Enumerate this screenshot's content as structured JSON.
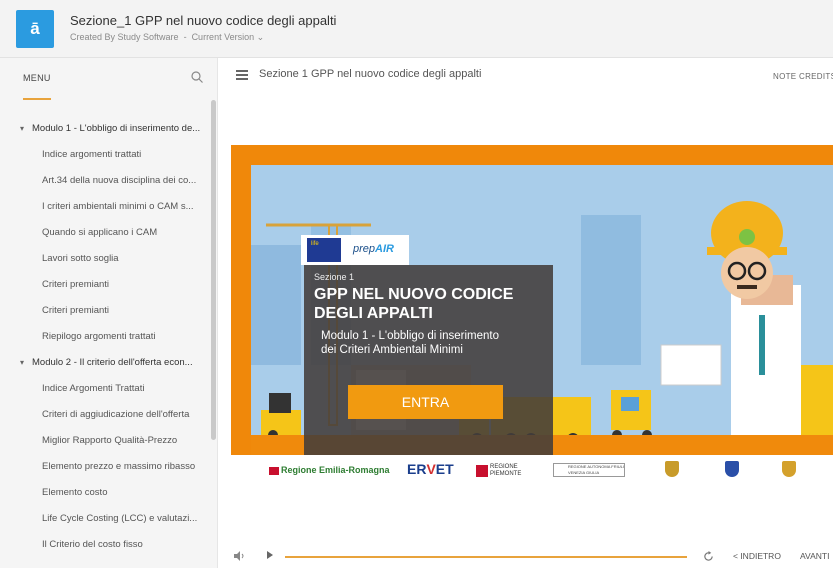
{
  "app": {
    "logo_glyph": "ā",
    "course_title": "Sezione_1 GPP nel nuovo codice degli appalti",
    "created_by": "Created By Study Software",
    "version": "Current Version ⌄"
  },
  "sidebar": {
    "menu_label": "MENU",
    "items": [
      {
        "type": "module",
        "label": "Modulo 1 - L'obbligo di inserimento de..."
      },
      {
        "type": "item",
        "label": "Indice argomenti trattati"
      },
      {
        "type": "item",
        "label": "Art.34 della nuova disciplina dei co..."
      },
      {
        "type": "item",
        "label": "I criteri ambientali minimi o CAM s..."
      },
      {
        "type": "item",
        "label": "Quando si applicano i CAM"
      },
      {
        "type": "item",
        "label": "Lavori sotto soglia"
      },
      {
        "type": "item",
        "label": "Criteri premianti"
      },
      {
        "type": "item",
        "label": "Criteri premianti"
      },
      {
        "type": "item",
        "label": "Riepilogo argomenti trattati"
      },
      {
        "type": "module",
        "label": "Modulo 2 - Il criterio dell'offerta econ..."
      },
      {
        "type": "item",
        "label": "Indice Argomenti Trattati"
      },
      {
        "type": "item",
        "label": "Criteri di aggiudicazione dell'offerta"
      },
      {
        "type": "item",
        "label": "Miglior Rapporto Qualità-Prezzo"
      },
      {
        "type": "item",
        "label": "Elemento prezzo e massimo ribasso"
      },
      {
        "type": "item",
        "label": "Elemento costo"
      },
      {
        "type": "item",
        "label": "Life Cycle Costing (LCC) e valutazi..."
      },
      {
        "type": "item",
        "label": "Il Criterio del costo fisso"
      }
    ]
  },
  "content": {
    "title": "Sezione 1 GPP nel nuovo codice degli appalti",
    "note": "NOTE",
    "credits": "CREDITS"
  },
  "slide": {
    "kicker": "Sezione 1",
    "heading_line1": "GPP NEL NUOVO CODICE",
    "heading_line2": "DEGLI APPALTI",
    "subtitle_line1": "Modulo 1 - L'obbligo di inserimento",
    "subtitle_line2": "dei Criteri Ambientali Minimi",
    "enter_label": "ENTRA",
    "prepair_a": "prep",
    "prepair_b": "AIR",
    "eu_label": "life",
    "logos": {
      "emilia": "Regione Emilia-Romagna",
      "ervet_a": "ER",
      "ervet_b": "V",
      "ervet_c": "ET",
      "piemonte_a": "REGIONE",
      "piemonte_b": "PIEMONTE",
      "fvg": "REGIONE AUTONOMA FRIULI VENEZIA GIULIA"
    }
  },
  "player": {
    "progress": 1.0,
    "back_label": "< INDIETRO",
    "next_label": "AVANTI"
  },
  "colors": {
    "accent": "#e8a33c",
    "logo_bg": "#2b9be0",
    "slide_orange": "#f0880a",
    "enter_btn": "#f19a10"
  }
}
